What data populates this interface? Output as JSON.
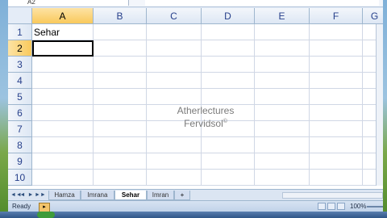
{
  "namebox": {
    "value": "A2"
  },
  "columns": [
    "A",
    "B",
    "C",
    "D",
    "E",
    "F",
    "G"
  ],
  "rows": [
    "1",
    "2",
    "3",
    "4",
    "5",
    "6",
    "7",
    "8",
    "9",
    "10"
  ],
  "active_column": "A",
  "active_row": "2",
  "cells": {
    "A1": "Sehar"
  },
  "watermark": {
    "line1": "Atherlectures",
    "line2": "Fervidsol",
    "mark": "©"
  },
  "sheet_nav": [
    "◄◄",
    "◄",
    "►",
    "►►"
  ],
  "sheet_tabs": [
    {
      "label": "Hamza",
      "active": false
    },
    {
      "label": "Imrana",
      "active": false
    },
    {
      "label": "Sehar",
      "active": true
    },
    {
      "label": "Imran",
      "active": false
    }
  ],
  "new_sheet_icon": "insert-worksheet-icon",
  "status": {
    "text": "Ready",
    "zoom": "100%"
  },
  "colors": {
    "header_bg": "#dde7f4",
    "active_header": "#f9c95c",
    "grid_line": "#d0d7e5",
    "watermark": "#7a7a7a"
  }
}
